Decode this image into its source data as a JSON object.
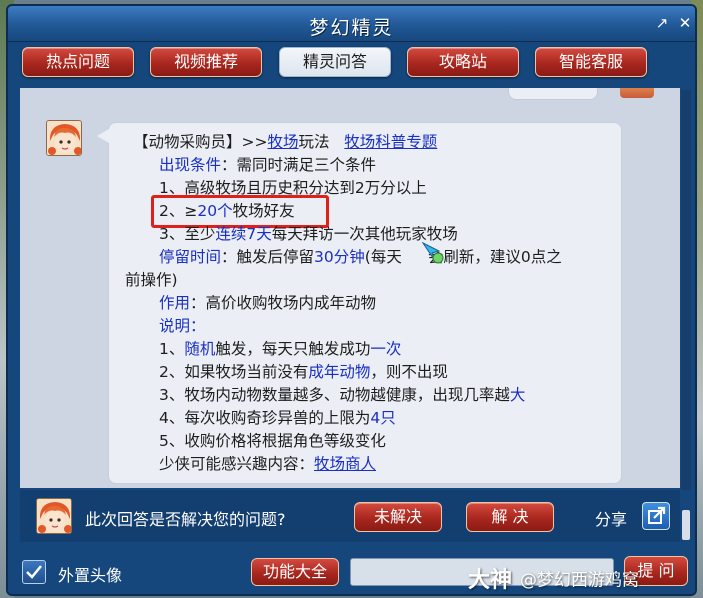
{
  "window": {
    "title": "梦幻精灵",
    "restore_glyph": "↗",
    "close_glyph": "✕"
  },
  "tabs": [
    {
      "label": "热点问题",
      "active": false
    },
    {
      "label": "视频推荐",
      "active": false
    },
    {
      "label": "精灵问答",
      "active": true
    },
    {
      "label": "攻略站",
      "active": false
    },
    {
      "label": "智能客服",
      "active": false
    }
  ],
  "answer": {
    "header_prefix": "【动物采购员】>>",
    "header_link1": "牧场",
    "header_mid": "玩法",
    "header_link2": "牧场科普专题",
    "cond_label": "出现条件",
    "cond_text": "：需同时满足三个条件",
    "cond1": "1、高级牧场且历史积分达到2万分以上",
    "cond2_prefix": "2、≥",
    "cond2_blue": "20个",
    "cond2_suffix": "牧场好友",
    "cond3_prefix": "3、至少",
    "cond3_blue": "连续7天",
    "cond3_suffix": "每天拜访一次其他玩家牧场",
    "stay_label": "停留时间",
    "stay_text1": "：触发后停留",
    "stay_blue": "30分钟",
    "stay_text2": "(每天",
    "stay_text3": "会刷新，建议0点之",
    "stay_line2": "前操作)",
    "use_label": "作用",
    "use_text": "：高价收购牧场内成年动物",
    "note_label": "说明",
    "note_colon": "：",
    "note1_prefix": "1、",
    "note1_blue1": "随机",
    "note1_mid": "触发，每天只触发成功",
    "note1_blue2": "一次",
    "note2_prefix": "2、如果牧场当前没有",
    "note2_blue": "成年动物",
    "note2_suffix": "，则不出现",
    "note3_prefix": "3、牧场内动物数量越多、动物越健康，出现几率越",
    "note3_blue": "大",
    "note4_prefix": "4、每次收购奇珍异兽的上限为",
    "note4_blue": "4只",
    "note5": "5、收购价格将根据角色等级变化",
    "related_label": "少侠可能感兴趣内容：",
    "related_link": "牧场商人"
  },
  "feedback": {
    "question": "此次回答是否解决您的问题?",
    "unsolved": "未解决",
    "solved": "解 决",
    "share": "分享"
  },
  "bottom": {
    "checkbox_label": "外置头像",
    "checkbox_checked": true,
    "func_button": "功能大全",
    "input_value": "",
    "send_button": "提 问"
  },
  "watermark": {
    "brand": "大神",
    "author": "@梦幻西游鸡窝"
  },
  "colors": {
    "frame": "#15467c",
    "tab_red": "#a8271e",
    "content_bg": "#cdd5e2",
    "bubble_bg": "#ebeff5",
    "link_blue": "#1a2fc4",
    "highlight_red": "#e0211b"
  }
}
